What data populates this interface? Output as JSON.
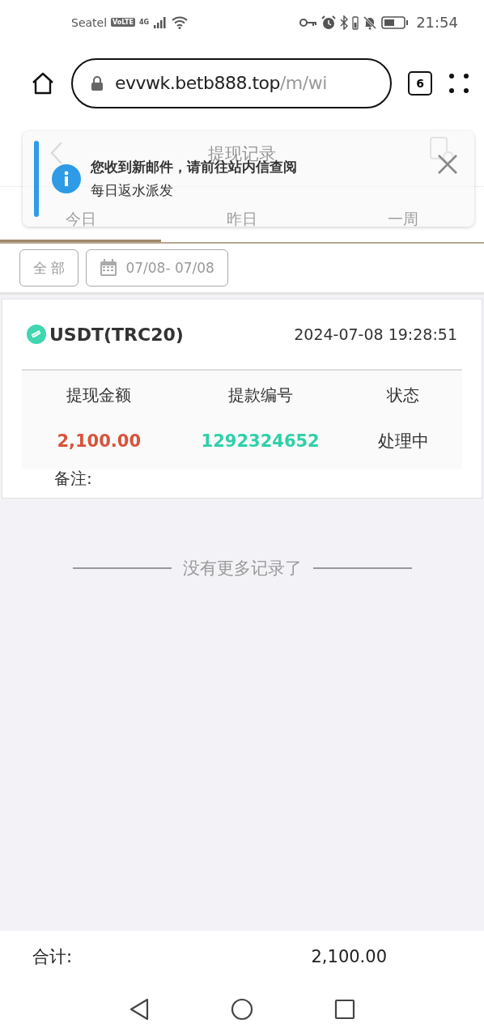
{
  "status_bar": {
    "carrier": "Seatel",
    "volte": "VoLTE",
    "network": "4G",
    "time": "21:54"
  },
  "browser": {
    "url_host": "evvwk.betb888.top",
    "url_path": "/m/wi",
    "tab_count": "6"
  },
  "header": {
    "title": "提现记录"
  },
  "tabs": [
    {
      "label": "今日",
      "selected": true
    },
    {
      "label": "昨日",
      "selected": false
    },
    {
      "label": "一周",
      "selected": false
    }
  ],
  "notification": {
    "title": "您收到新邮件，请前往站内信查阅",
    "message": "每日返水派发"
  },
  "filter": {
    "type_button": "全 部",
    "date_range": "07/08- 07/08"
  },
  "record": {
    "currency": "USDT(TRC20)",
    "time": "2024-07-08 19:28:51",
    "columns": [
      "提现金额",
      "提款编号",
      "状态"
    ],
    "amount": "2,100.00",
    "order_no": "1292324652",
    "status": "处理中",
    "remark_label": "备注:"
  },
  "end_text": "没有更多记录了",
  "footer": {
    "total_label": "合计:",
    "total_value": "2,100.00"
  }
}
